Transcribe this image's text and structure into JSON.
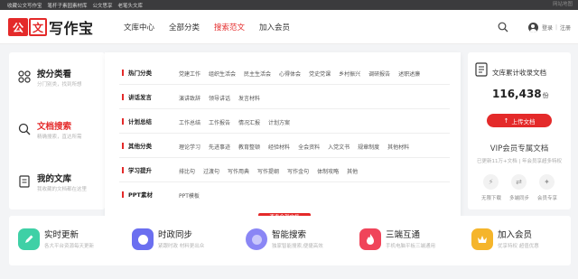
{
  "topbar": {
    "links": [
      "收藏公文写作宝",
      "笔杆子素园素材库",
      "公文思享",
      "老笔头文库"
    ],
    "right_text": "网站地图"
  },
  "header": {
    "logo_char1": "公",
    "logo_char2": "文",
    "logo_text": "写作宝",
    "nav": [
      {
        "label": "文库中心",
        "active": false
      },
      {
        "label": "全部分类",
        "active": false
      },
      {
        "label": "搜索范文",
        "active": true
      },
      {
        "label": "加入会员",
        "active": false
      }
    ],
    "login": "登录",
    "separator": "|",
    "register": "注册"
  },
  "left_panel": {
    "items": [
      {
        "title": "按分类看",
        "sub": "分门别类，找到所想",
        "icon": "grid-icon",
        "highlight": false
      },
      {
        "title": "文档搜索",
        "sub": "精确搜索，直达所需",
        "icon": "search-icon",
        "highlight": true
      },
      {
        "title": "我的文库",
        "sub": "我收藏的文档都在这里",
        "icon": "document-icon",
        "highlight": false
      }
    ]
  },
  "dropdown": {
    "rows": [
      {
        "category": "热门分类",
        "tags": [
          "党建工作",
          "组织生活会",
          "民主生活会",
          "心得体会",
          "党史党课",
          "乡村振兴",
          "调研报告",
          "述职述廉"
        ]
      },
      {
        "category": "讲话发言",
        "tags": [
          "演讲致辞",
          "领导讲话",
          "发言材料"
        ]
      },
      {
        "category": "计划总结",
        "tags": [
          "工作总结",
          "工作报告",
          "情况汇报",
          "计划方案"
        ]
      },
      {
        "category": "其他分类",
        "tags": [
          "理论学习",
          "先进事迹",
          "教育整顿",
          "经验材料",
          "全会资料",
          "入党文书",
          "规章制度",
          "其他材料"
        ]
      },
      {
        "category": "学习提升",
        "tags": [
          "排比句",
          "过渡句",
          "写作用典",
          "写作提纲",
          "写作金句",
          "体制攻略",
          "其他"
        ]
      },
      {
        "category": "PPT素材",
        "tags": [
          "PPT模板"
        ]
      }
    ],
    "view_all": "查看全部文档"
  },
  "right_panel": {
    "title": "文库累计收录文档",
    "count": "116,438",
    "count_unit": "份",
    "upload_label": "上传文档",
    "upload_arrow": "↑",
    "vip_title": "VIP会员专属文档",
    "vip_sub": "已更新11万+文档 | 年会员享超多特权",
    "perks": [
      {
        "label": "无限下载",
        "icon": "download-icon",
        "glyph": "⚡"
      },
      {
        "label": "多端同步",
        "icon": "sync-icon",
        "glyph": "⇄"
      },
      {
        "label": "会员专享",
        "icon": "crown-icon",
        "glyph": "✦"
      }
    ]
  },
  "features": [
    {
      "title": "实时更新",
      "sub": "各大平台资源每天更新",
      "icon": "edit-icon",
      "color": "#3fd0a6"
    },
    {
      "title": "时政同步",
      "sub": "紧跟时政 材料更出众",
      "icon": "sync-icon",
      "color": "#6b6ff0"
    },
    {
      "title": "智能搜索",
      "sub": "独家智能搜索,便捷高效",
      "icon": "smart-search-icon",
      "color": "#8a86f5"
    },
    {
      "title": "三端互通",
      "sub": "手机电脑平板三端通用",
      "icon": "flame-icon",
      "color": "#f0445a"
    },
    {
      "title": "加入会员",
      "sub": "优享特权 超值优惠",
      "icon": "vip-icon",
      "color": "#f5b52b"
    }
  ],
  "colors": {
    "accent": "#e42a2a",
    "topbar": "#3b3b3d"
  }
}
